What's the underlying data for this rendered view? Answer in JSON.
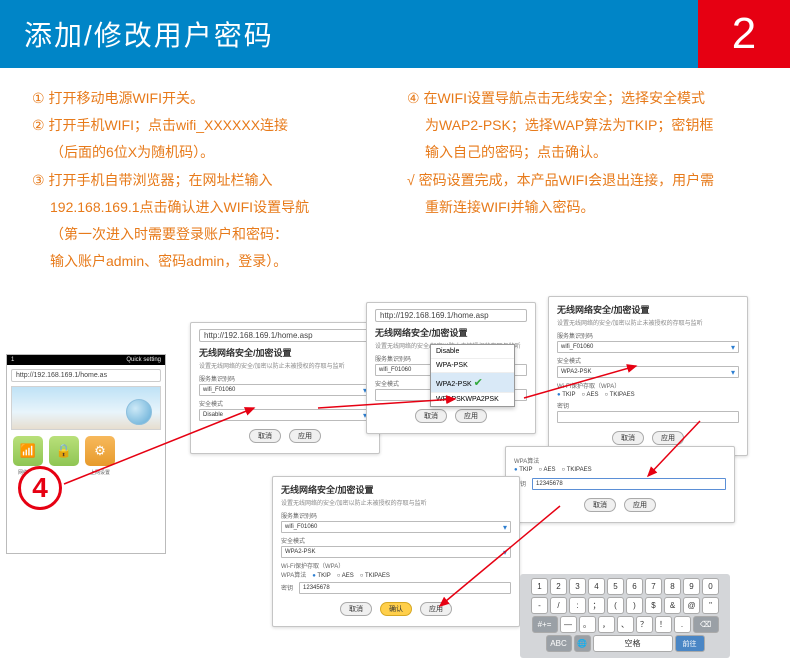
{
  "header": {
    "title": "添加/修改用户密码",
    "badge": "2"
  },
  "instructions": {
    "left": [
      {
        "num": "①",
        "text": "打开移动电源WIFI开关。"
      },
      {
        "num": "②",
        "text": "打开手机WIFI；点击wifi_XXXXXX连接",
        "cont": "（后面的6位X为随机码）。"
      },
      {
        "num": "③",
        "text": "打开手机自带浏览器；在网址栏输入",
        "cont": "192.168.169.1点击确认进入WIFI设置导航",
        "cont2": "（第一次进入时需要登录账户和密码：",
        "cont3": "输入账户admin、密码admin，登录）。"
      }
    ],
    "right": [
      {
        "num": "④",
        "text": "在WIFI设置导航点击无线安全；选择安全模式",
        "cont": "为WAP2-PSK；选择WAP算法为TKIP；密钥框",
        "cont2": "输入自己的密码；点击确认。"
      },
      {
        "num": "√",
        "text": "密码设置完成，本产品WIFI会退出连接，用户需",
        "cont": "重新连接WIFI并输入密码。"
      }
    ]
  },
  "phone": {
    "status_left": "1",
    "status_right": "Quick setting",
    "url": "http://192.168.169.1/home.as",
    "icon_labels": [
      "网络状态",
      "",
      "上网设置"
    ]
  },
  "panels": {
    "url": "http://192.168.169.1/home.asp",
    "section_title": "无线网络安全/加密设置",
    "section_sub": "设置无线网络的安全/加密以防止未被授权的存取与监听",
    "ssid_label": "服务集识别码",
    "ssid_value": "wifi_F01060",
    "mode_label": "安全模式",
    "mode_disable": "Disable",
    "mode_wpa2": "WPA2-PSK",
    "dropdown": [
      "Disable",
      "WPA-PSK",
      "WPA2-PSK",
      "WPAPSKWPA2PSK"
    ],
    "algo_label": "Wi-Fi保护存取（WPA）",
    "wpa_algo_label": "WPA算法",
    "radios": [
      "TKIP",
      "AES",
      "TKIPAES"
    ],
    "key_label": "密钥",
    "key_value": "12345678",
    "btn_cancel": "取消",
    "btn_apply": "应用",
    "btn_ok": "确认"
  },
  "stepbadge": "4",
  "keyboard": {
    "rows": [
      [
        "1",
        "2",
        "3",
        "4",
        "5",
        "6",
        "7",
        "8",
        "9",
        "0"
      ],
      [
        "-",
        "/",
        ":",
        "；",
        "(",
        ")",
        "$",
        "&",
        "@",
        "\""
      ],
      [
        "—",
        "。",
        "，",
        "、",
        "？",
        "！",
        "."
      ],
      [
        "ABC",
        "",
        "空格",
        "",
        "前往"
      ]
    ]
  }
}
